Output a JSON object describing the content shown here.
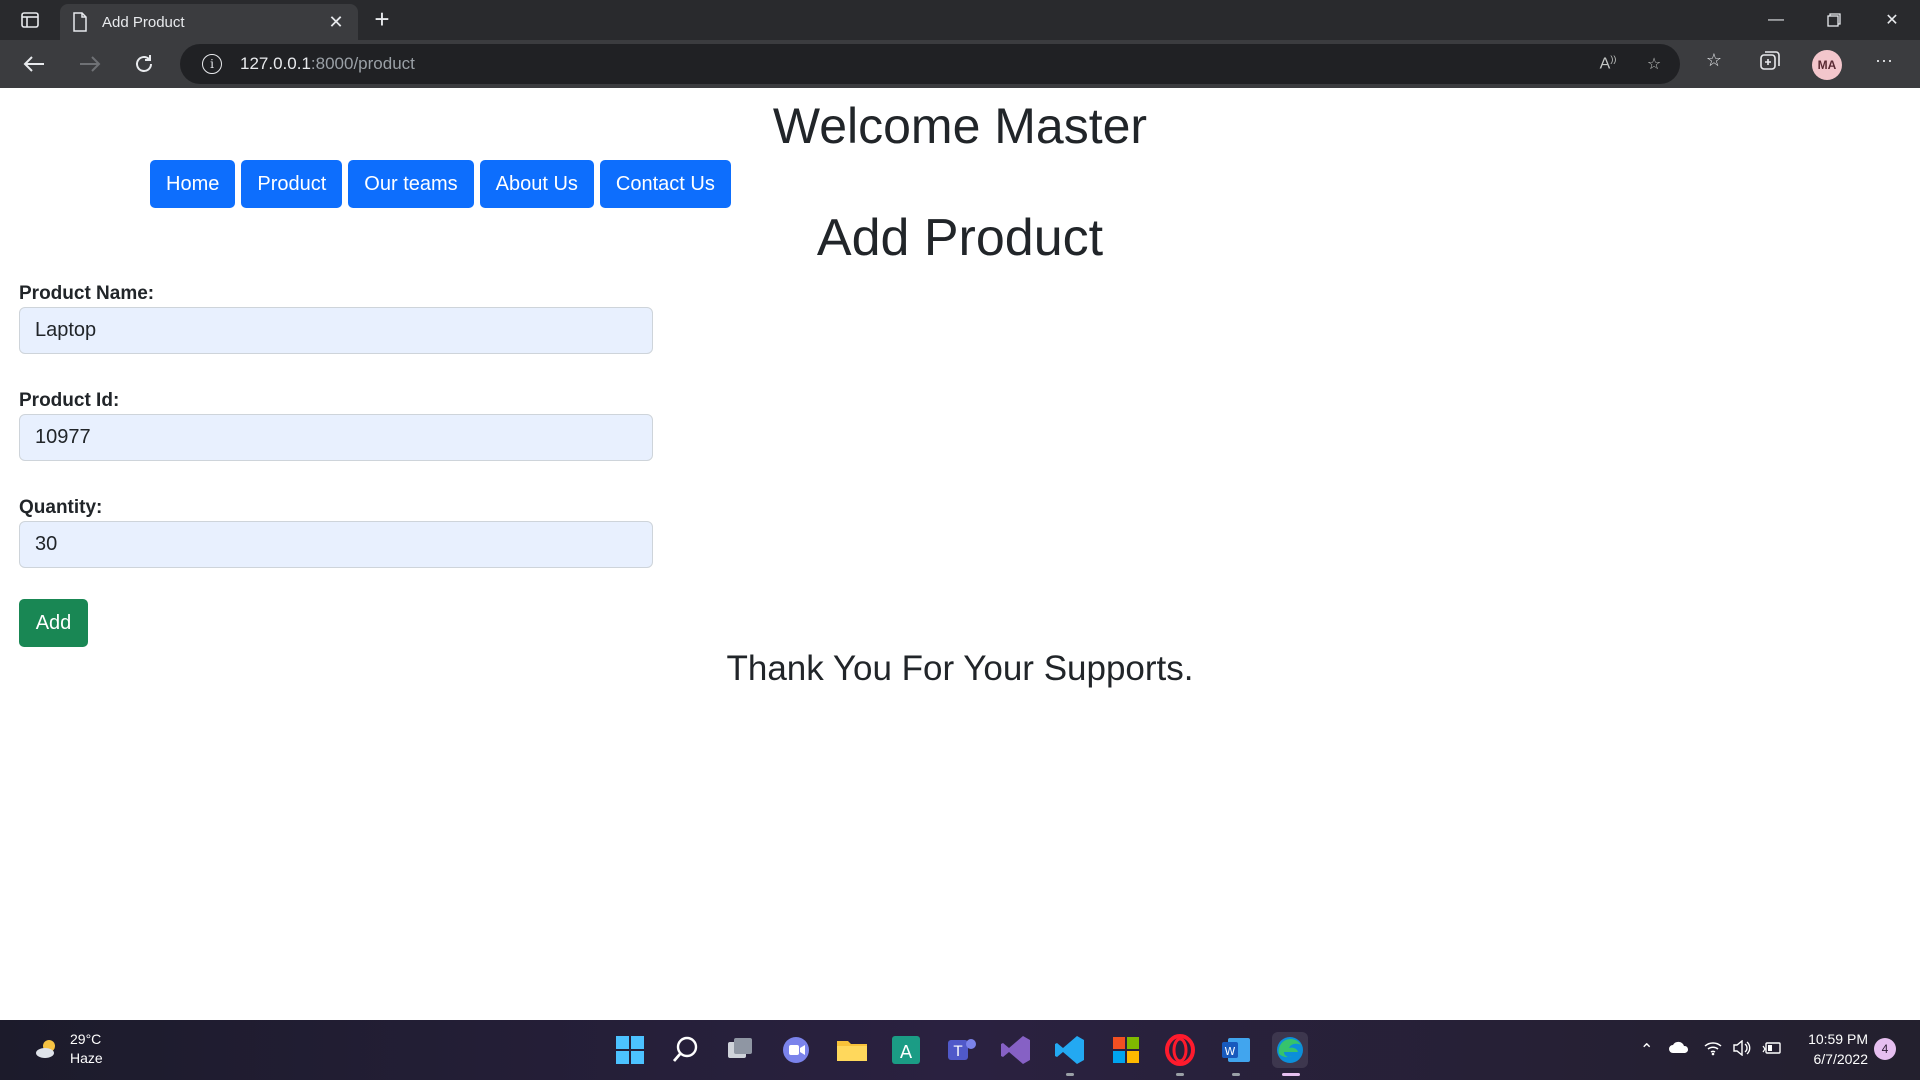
{
  "browser": {
    "tab_title": "Add Product",
    "url_host": "127.0.0.1",
    "url_path": ":8000/product",
    "profile_initials": "MA"
  },
  "page": {
    "welcome": "Welcome Master",
    "nav": [
      "Home",
      "Product",
      "Our teams",
      "About Us",
      "Contact Us"
    ],
    "heading": "Add Product",
    "form": {
      "product_name_label": "Product Name:",
      "product_name_value": "Laptop",
      "product_id_label": "Product Id:",
      "product_id_value": "10977",
      "quantity_label": "Quantity:",
      "quantity_value": "30",
      "add_label": "Add"
    },
    "footer": "Thank You For Your Supports."
  },
  "taskbar": {
    "temperature": "29°C",
    "condition": "Haze",
    "time": "10:59 PM",
    "date": "6/7/2022",
    "notifications": "4"
  },
  "colors": {
    "primary": "#0d6efd",
    "success": "#198754",
    "input_bg": "#e8f0fe"
  }
}
